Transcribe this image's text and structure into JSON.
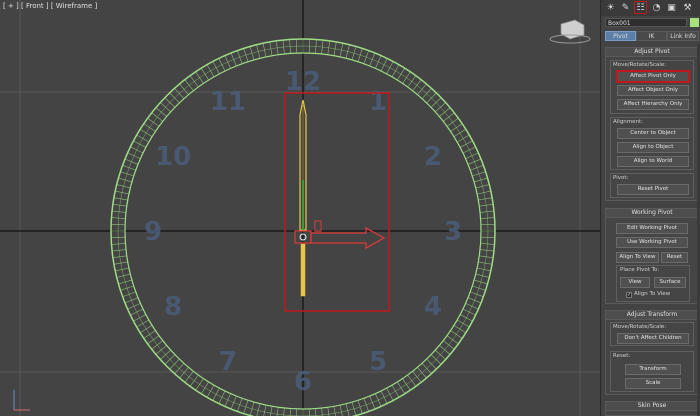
{
  "viewport": {
    "label": "[ + ] [ Front ] [ Wireframe ]",
    "viewcube_icon": "viewcube-icon",
    "axis_icon": "axis-tripod-icon",
    "colors": {
      "background": "#444444",
      "grid": "#595959",
      "axis": "#111111",
      "wireframe": "#9fdc86",
      "hand": "#e8c64a",
      "selection": "#c0181c",
      "gizmo": "#d93a3a",
      "numerals": "#4b5d7a"
    },
    "clock_numerals": [
      "12",
      "1",
      "2",
      "3",
      "4",
      "5",
      "6",
      "7",
      "8",
      "9",
      "10",
      "11"
    ]
  },
  "panel": {
    "tab_icons": [
      "sun-icon",
      "modify-icon",
      "hierarchy-icon",
      "motion-icon",
      "display-icon",
      "utilities-icon"
    ],
    "active_tab": "hierarchy-icon",
    "object_name": "Box001",
    "object_color": "#a8e07c",
    "subtabs": [
      "Pivot",
      "IK",
      "Link Info"
    ],
    "active_subtab": "Pivot",
    "adjust_pivot": {
      "title": "Adjust Pivot",
      "move_label": "Move/Rotate/Scale:",
      "affect_pivot": "Affect Pivot Only",
      "affect_object": "Affect Object Only",
      "affect_hierarchy": "Affect Hierarchy Only",
      "alignment_label": "Alignment:",
      "center_to_object": "Center to Object",
      "align_to_object": "Align to Object",
      "align_to_world": "Align to World",
      "pivot_label": "Pivot:",
      "reset_pivot": "Reset Pivot"
    },
    "working_pivot": {
      "title": "Working Pivot",
      "edit": "Edit Working Pivot",
      "use": "Use Working Pivot",
      "align_to_view": "Align To View",
      "reset": "Reset",
      "place_label": "Place Pivot To:",
      "view": "View",
      "surface": "Surface",
      "align_to_view_check": "Align To View",
      "align_checked": true
    },
    "adjust_transform": {
      "title": "Adjust Transform",
      "move_label": "Move/Rotate/Scale:",
      "dont_affect": "Don't Affect Children",
      "reset_label": "Reset:",
      "transform": "Transform",
      "scale": "Scale"
    },
    "skin_pose": {
      "title": "Skin Pose"
    }
  }
}
